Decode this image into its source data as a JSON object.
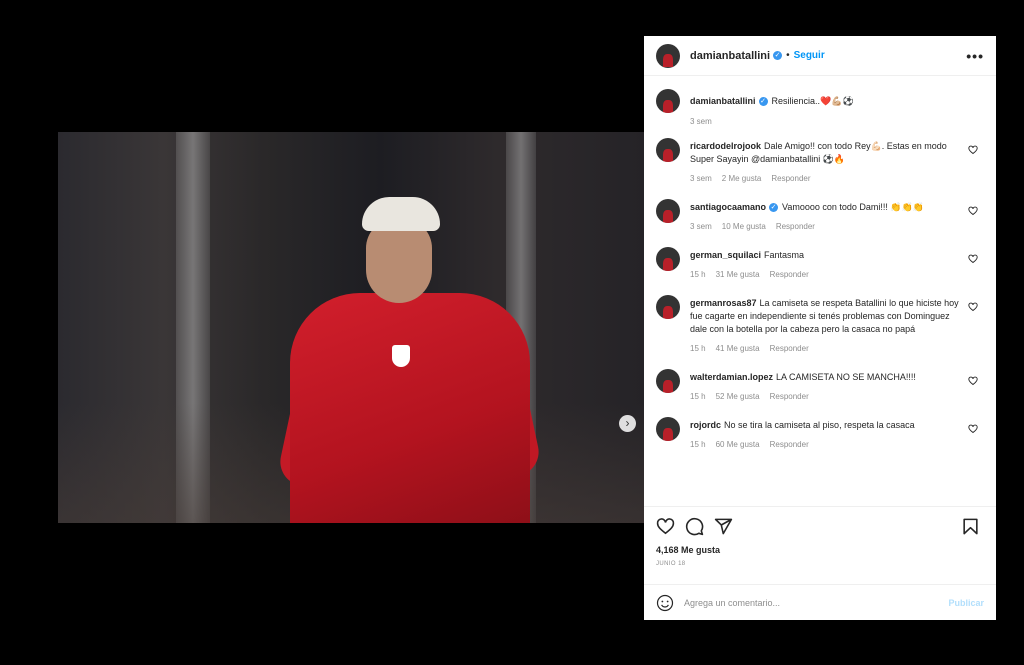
{
  "post": {
    "username": "damianbatallini",
    "follow_label": "Seguir",
    "separator": "•",
    "more_label": "•••",
    "carousel_dots": 3,
    "caption": {
      "username": "damianbatallini",
      "text": "Resiliencia..❤️💪🏼⚽",
      "time": "3 sem"
    }
  },
  "comments": [
    {
      "username": "ricardodelrojook",
      "verified": false,
      "text": "Dale Amigo!! con todo Rey💪🏻. Estas en modo Super Sayayin @damianbatallini ⚽🔥",
      "time": "3 sem",
      "likes": "2 Me gusta",
      "reply": "Responder"
    },
    {
      "username": "santiagocaamano",
      "verified": true,
      "text": "Vamoooo con todo Dami!!! 👏👏👏",
      "time": "3 sem",
      "likes": "10 Me gusta",
      "reply": "Responder"
    },
    {
      "username": "german_squilaci",
      "verified": false,
      "text": "Fantasma",
      "time": "15 h",
      "likes": "31 Me gusta",
      "reply": "Responder"
    },
    {
      "username": "germanrosas87",
      "verified": false,
      "text": "La camiseta se respeta Batallini lo que hiciste hoy fue cagarte en independiente si tenés problemas con Dominguez dale con la botella por la cabeza pero la casaca no papá",
      "time": "15 h",
      "likes": "41 Me gusta",
      "reply": "Responder"
    },
    {
      "username": "walterdamian.lopez",
      "verified": false,
      "text": "LA CAMISETA NO SE MANCHA!!!!",
      "time": "15 h",
      "likes": "52 Me gusta",
      "reply": "Responder"
    },
    {
      "username": "rojordc",
      "verified": false,
      "text": "No se tira la camiseta al piso, respeta la casaca",
      "time": "15 h",
      "likes": "60 Me gusta",
      "reply": "Responder"
    }
  ],
  "actions": {
    "icons": [
      "heart-icon",
      "comment-icon",
      "share-icon",
      "bookmark-icon"
    ],
    "likes_count": "4,168 Me gusta",
    "date": "JUNIO 18"
  },
  "add_comment": {
    "placeholder": "Agrega un comentario...",
    "publish_label": "Publicar"
  },
  "colors": {
    "accent": "#0095f6",
    "verified": "#3897f0",
    "publish_disabled": "#b2dffc",
    "jacket": "#c31a26"
  }
}
